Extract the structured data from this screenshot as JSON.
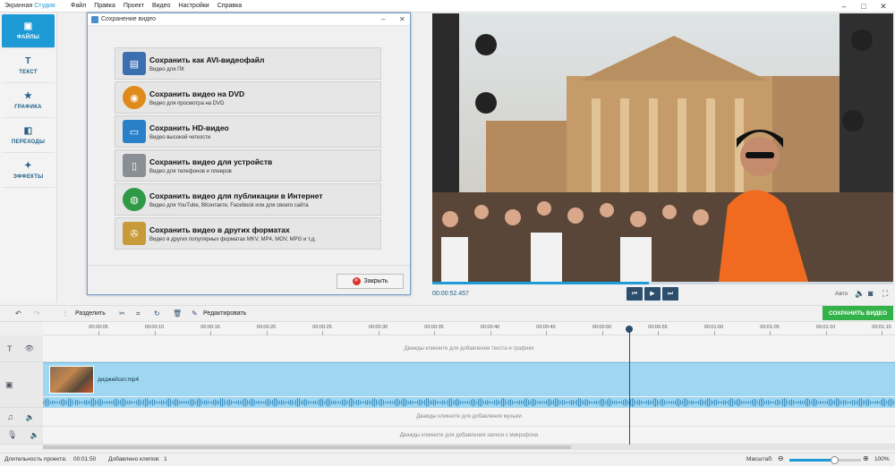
{
  "app": {
    "title_main": "Экранная",
    "title_accent": "Студия"
  },
  "menu": [
    "Файл",
    "Правка",
    "Проект",
    "Видео",
    "Настройки",
    "Справка"
  ],
  "sidebar": [
    {
      "label": "ФАЙЛЫ",
      "icon": "folder-icon",
      "active": true
    },
    {
      "label": "ТЕКСТ",
      "icon": "text-icon",
      "active": false
    },
    {
      "label": "ГРАФИКА",
      "icon": "graphics-icon",
      "active": false
    },
    {
      "label": "ПЕРЕХОДЫ",
      "icon": "transitions-icon",
      "active": false
    },
    {
      "label": "ЭФФЕКТЫ",
      "icon": "effects-icon",
      "active": false
    }
  ],
  "dialog": {
    "title": "Сохранение видео",
    "options": [
      {
        "title": "Сохранить как AVI-видеофайл",
        "subtitle": "Видео для ПК",
        "icon": "avi-file-icon",
        "color": "#3b6fb0"
      },
      {
        "title": "Сохранить видео на DVD",
        "subtitle": "Видео для просмотра на DVD",
        "icon": "dvd-disc-icon",
        "color": "#e08a1c"
      },
      {
        "title": "Сохранить HD-видео",
        "subtitle": "Видео высокой четкости",
        "icon": "hd-monitor-icon",
        "color": "#2a7fc9"
      },
      {
        "title": "Сохранить видео для устройств",
        "subtitle": "Видео для телефонов и плееров",
        "icon": "phone-icon",
        "color": "#8a8f96"
      },
      {
        "title": "Сохранить видео для публикации в Интернет",
        "subtitle": "Видео для YouTube, ВКонтакте, Facebook или для своего сайта",
        "icon": "globe-icon",
        "color": "#2f9a45"
      },
      {
        "title": "Сохранить видео в других форматах",
        "subtitle": "Видео в других популярных форматах MKV, MP4, MOV, MPG и т.д.",
        "icon": "film-reel-icon",
        "color": "#c79a3a"
      }
    ],
    "close_label": "Закрыть"
  },
  "player": {
    "time": "00:00:52.457",
    "progress": 0.47,
    "volume_label": "Авто"
  },
  "toolbar": {
    "split_label": "Разделить",
    "edit_label": "Редактировать",
    "save_video_label": "СОХРАНИТЬ ВИДЕО"
  },
  "ruler": [
    "00:00:05",
    "00:00:10",
    "00:00:15",
    "00:00:20",
    "00:00:25",
    "00:00:30",
    "00:00:35",
    "00:00:40",
    "00:00:45",
    "00:00:50",
    "00:00:55",
    "00:01:00",
    "00:01:05",
    "00:01:10",
    "00:01:15"
  ],
  "tracks": {
    "text_hint": "Дважды кликните для добавления текста и графики",
    "clip_name": "диджейсет.mp4",
    "music_hint": "Дважды кликните для добавления музыки",
    "mic_hint": "Дважды кликните для добавления записи с микрофона"
  },
  "status": {
    "duration_label": "Длительность проекта:",
    "duration": "00:01:50",
    "clips_label": "Добавлено клипов:",
    "clips": "1",
    "zoom_label": "Масштаб:",
    "zoom": "100%",
    "zoom_level": 0.62
  }
}
